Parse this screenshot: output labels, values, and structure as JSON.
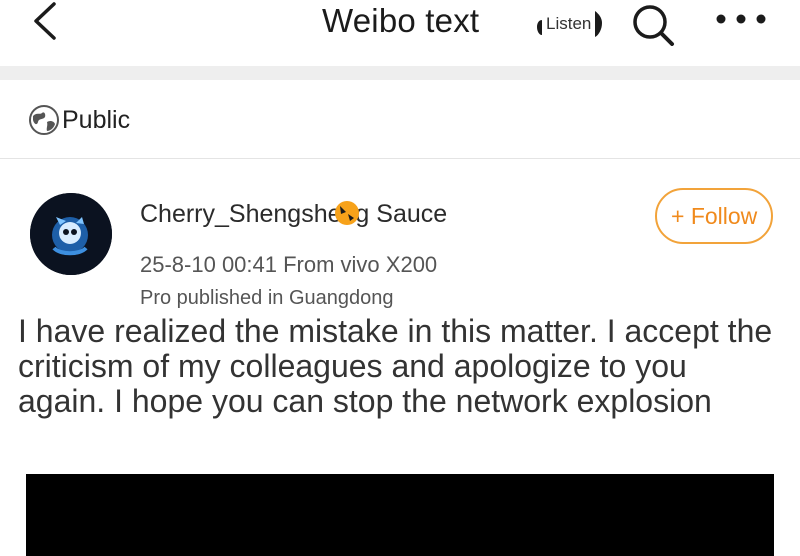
{
  "nav": {
    "title": "Weibo text",
    "listen_label": "Listen"
  },
  "visibility": {
    "label": "Public"
  },
  "post": {
    "author": "Cherry_Shengsheng Sauce",
    "timestamp_device": "25-8-10 00:41 From vivo X200",
    "location_line": "Pro published in Guangdong",
    "follow_label": "+ Follow",
    "text": "I have realized the mistake in this matter. I accept the criticism of my colleagues and apologize to you again. I hope you can stop the network explosion"
  },
  "colors": {
    "follow_accent": "#f08a1c",
    "band_gray": "#eeeeee"
  },
  "icons": [
    "back-arrow-icon",
    "speaker-icon",
    "search-icon",
    "more-dots-icon",
    "globe-icon",
    "badge-icon"
  ]
}
